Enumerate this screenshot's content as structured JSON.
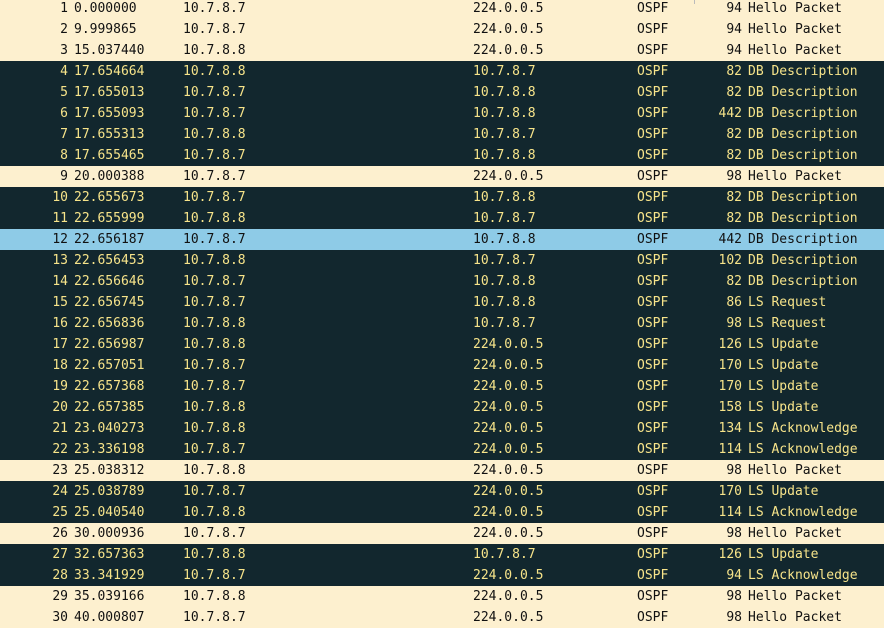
{
  "packet_list": {
    "rows": [
      {
        "no": "1",
        "time": "0.000000",
        "src": "10.7.8.7",
        "dst": "224.0.0.5",
        "proto": "OSPF",
        "len": "94",
        "info": "Hello Packet",
        "style": "hello"
      },
      {
        "no": "2",
        "time": "9.999865",
        "src": "10.7.8.7",
        "dst": "224.0.0.5",
        "proto": "OSPF",
        "len": "94",
        "info": "Hello Packet",
        "style": "hello"
      },
      {
        "no": "3",
        "time": "15.037440",
        "src": "10.7.8.8",
        "dst": "224.0.0.5",
        "proto": "OSPF",
        "len": "94",
        "info": "Hello Packet",
        "style": "hello"
      },
      {
        "no": "4",
        "time": "17.654664",
        "src": "10.7.8.8",
        "dst": "10.7.8.7",
        "proto": "OSPF",
        "len": "82",
        "info": "DB Description",
        "style": "dark"
      },
      {
        "no": "5",
        "time": "17.655013",
        "src": "10.7.8.7",
        "dst": "10.7.8.8",
        "proto": "OSPF",
        "len": "82",
        "info": "DB Description",
        "style": "dark"
      },
      {
        "no": "6",
        "time": "17.655093",
        "src": "10.7.8.7",
        "dst": "10.7.8.8",
        "proto": "OSPF",
        "len": "442",
        "info": "DB Description",
        "style": "dark"
      },
      {
        "no": "7",
        "time": "17.655313",
        "src": "10.7.8.8",
        "dst": "10.7.8.7",
        "proto": "OSPF",
        "len": "82",
        "info": "DB Description",
        "style": "dark"
      },
      {
        "no": "8",
        "time": "17.655465",
        "src": "10.7.8.7",
        "dst": "10.7.8.8",
        "proto": "OSPF",
        "len": "82",
        "info": "DB Description",
        "style": "dark"
      },
      {
        "no": "9",
        "time": "20.000388",
        "src": "10.7.8.7",
        "dst": "224.0.0.5",
        "proto": "OSPF",
        "len": "98",
        "info": "Hello Packet",
        "style": "hello"
      },
      {
        "no": "10",
        "time": "22.655673",
        "src": "10.7.8.7",
        "dst": "10.7.8.8",
        "proto": "OSPF",
        "len": "82",
        "info": "DB Description",
        "style": "dark"
      },
      {
        "no": "11",
        "time": "22.655999",
        "src": "10.7.8.8",
        "dst": "10.7.8.7",
        "proto": "OSPF",
        "len": "82",
        "info": "DB Description",
        "style": "dark"
      },
      {
        "no": "12",
        "time": "22.656187",
        "src": "10.7.8.7",
        "dst": "10.7.8.8",
        "proto": "OSPF",
        "len": "442",
        "info": "DB Description",
        "style": "selected"
      },
      {
        "no": "13",
        "time": "22.656453",
        "src": "10.7.8.8",
        "dst": "10.7.8.7",
        "proto": "OSPF",
        "len": "102",
        "info": "DB Description",
        "style": "dark"
      },
      {
        "no": "14",
        "time": "22.656646",
        "src": "10.7.8.7",
        "dst": "10.7.8.8",
        "proto": "OSPF",
        "len": "82",
        "info": "DB Description",
        "style": "dark"
      },
      {
        "no": "15",
        "time": "22.656745",
        "src": "10.7.8.7",
        "dst": "10.7.8.8",
        "proto": "OSPF",
        "len": "86",
        "info": "LS Request",
        "style": "dark"
      },
      {
        "no": "16",
        "time": "22.656836",
        "src": "10.7.8.8",
        "dst": "10.7.8.7",
        "proto": "OSPF",
        "len": "98",
        "info": "LS Request",
        "style": "dark"
      },
      {
        "no": "17",
        "time": "22.656987",
        "src": "10.7.8.8",
        "dst": "224.0.0.5",
        "proto": "OSPF",
        "len": "126",
        "info": "LS Update",
        "style": "dark"
      },
      {
        "no": "18",
        "time": "22.657051",
        "src": "10.7.8.7",
        "dst": "224.0.0.5",
        "proto": "OSPF",
        "len": "170",
        "info": "LS Update",
        "style": "dark"
      },
      {
        "no": "19",
        "time": "22.657368",
        "src": "10.7.8.7",
        "dst": "224.0.0.5",
        "proto": "OSPF",
        "len": "170",
        "info": "LS Update",
        "style": "dark"
      },
      {
        "no": "20",
        "time": "22.657385",
        "src": "10.7.8.8",
        "dst": "224.0.0.5",
        "proto": "OSPF",
        "len": "158",
        "info": "LS Update",
        "style": "dark"
      },
      {
        "no": "21",
        "time": "23.040273",
        "src": "10.7.8.8",
        "dst": "224.0.0.5",
        "proto": "OSPF",
        "len": "134",
        "info": "LS Acknowledge",
        "style": "dark"
      },
      {
        "no": "22",
        "time": "23.336198",
        "src": "10.7.8.7",
        "dst": "224.0.0.5",
        "proto": "OSPF",
        "len": "114",
        "info": "LS Acknowledge",
        "style": "dark"
      },
      {
        "no": "23",
        "time": "25.038312",
        "src": "10.7.8.8",
        "dst": "224.0.0.5",
        "proto": "OSPF",
        "len": "98",
        "info": "Hello Packet",
        "style": "hello"
      },
      {
        "no": "24",
        "time": "25.038789",
        "src": "10.7.8.7",
        "dst": "224.0.0.5",
        "proto": "OSPF",
        "len": "170",
        "info": "LS Update",
        "style": "dark"
      },
      {
        "no": "25",
        "time": "25.040540",
        "src": "10.7.8.8",
        "dst": "224.0.0.5",
        "proto": "OSPF",
        "len": "114",
        "info": "LS Acknowledge",
        "style": "dark"
      },
      {
        "no": "26",
        "time": "30.000936",
        "src": "10.7.8.7",
        "dst": "224.0.0.5",
        "proto": "OSPF",
        "len": "98",
        "info": "Hello Packet",
        "style": "hello"
      },
      {
        "no": "27",
        "time": "32.657363",
        "src": "10.7.8.8",
        "dst": "10.7.8.7",
        "proto": "OSPF",
        "len": "126",
        "info": "LS Update",
        "style": "dark"
      },
      {
        "no": "28",
        "time": "33.341929",
        "src": "10.7.8.7",
        "dst": "224.0.0.5",
        "proto": "OSPF",
        "len": "94",
        "info": "LS Acknowledge",
        "style": "dark"
      },
      {
        "no": "29",
        "time": "35.039166",
        "src": "10.7.8.8",
        "dst": "224.0.0.5",
        "proto": "OSPF",
        "len": "98",
        "info": "Hello Packet",
        "style": "hello"
      },
      {
        "no": "30",
        "time": "40.000807",
        "src": "10.7.8.7",
        "dst": "224.0.0.5",
        "proto": "OSPF",
        "len": "98",
        "info": "Hello Packet",
        "style": "hello"
      }
    ]
  },
  "colors": {
    "hello_row_bg": "#fdf0cf",
    "hello_row_fg": "#111111",
    "dark_row_bg": "#12272e",
    "dark_row_fg": "#f7e48a",
    "selected_row_bg": "#8ecbe7",
    "selected_row_fg": "#111111"
  }
}
